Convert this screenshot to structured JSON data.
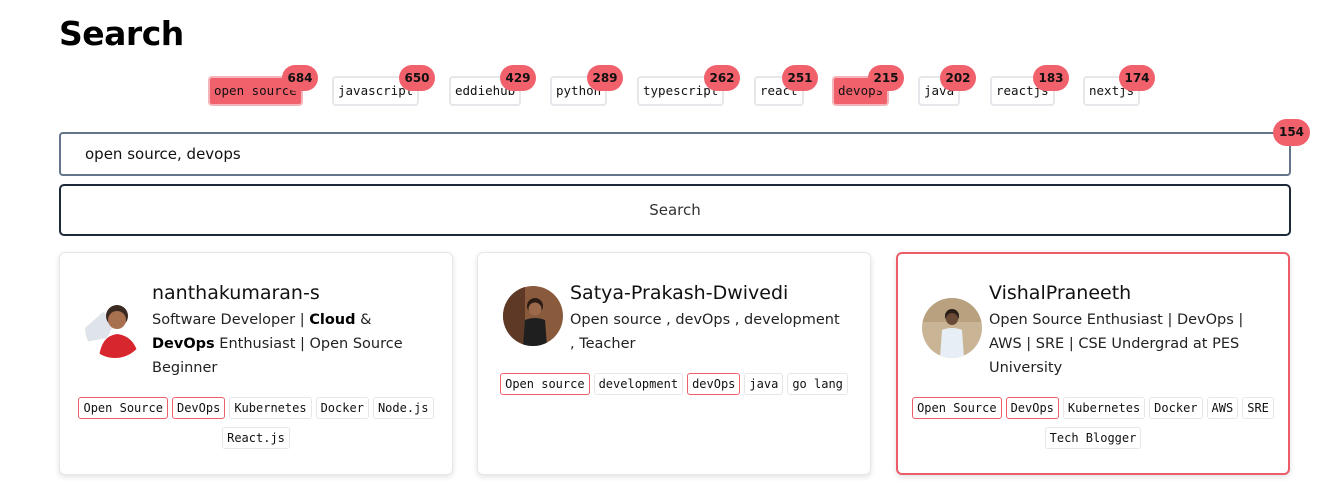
{
  "page": {
    "title": "Search"
  },
  "popular_tags": [
    {
      "label": "open source",
      "count": "684",
      "selected": true
    },
    {
      "label": "javascript",
      "count": "650",
      "selected": false
    },
    {
      "label": "eddiehub",
      "count": "429",
      "selected": false
    },
    {
      "label": "python",
      "count": "289",
      "selected": false
    },
    {
      "label": "typescript",
      "count": "262",
      "selected": false
    },
    {
      "label": "react",
      "count": "251",
      "selected": false
    },
    {
      "label": "devops",
      "count": "215",
      "selected": true
    },
    {
      "label": "java",
      "count": "202",
      "selected": false
    },
    {
      "label": "reactjs",
      "count": "183",
      "selected": false
    },
    {
      "label": "nextjs",
      "count": "174",
      "selected": false
    }
  ],
  "search": {
    "value": "open source, devops",
    "result_count": "154",
    "button_label": "Search"
  },
  "results": [
    {
      "username": "nanthakumaran-s",
      "bio_parts": [
        {
          "text": "Software Developer | ",
          "bold": false
        },
        {
          "text": "Cloud",
          "bold": true
        },
        {
          "text": " & ",
          "bold": false
        },
        {
          "text": "DevOps",
          "bold": true
        },
        {
          "text": " Enthusiast | Open Source Beginner",
          "bold": false
        }
      ],
      "tags": [
        {
          "label": "Open Source",
          "match": true
        },
        {
          "label": "DevOps",
          "match": true
        },
        {
          "label": "Kubernetes",
          "match": false
        },
        {
          "label": "Docker",
          "match": false
        },
        {
          "label": "Node.js",
          "match": false
        },
        {
          "label": "React.js",
          "match": false
        }
      ],
      "highlighted": false
    },
    {
      "username": "Satya-Prakash-Dwivedi",
      "bio_parts": [
        {
          "text": "Open source , devOps , development , Teacher",
          "bold": false
        }
      ],
      "tags": [
        {
          "label": "Open source",
          "match": true
        },
        {
          "label": "development",
          "match": false
        },
        {
          "label": "devOps",
          "match": true
        },
        {
          "label": "java",
          "match": false
        },
        {
          "label": "go lang",
          "match": false
        }
      ],
      "highlighted": false
    },
    {
      "username": "VishalPraneeth",
      "bio_parts": [
        {
          "text": "Open Source Enthusiast | DevOps | AWS | SRE | CSE Undergrad at PES University",
          "bold": false
        }
      ],
      "tags": [
        {
          "label": "Open Source",
          "match": true
        },
        {
          "label": "DevOps",
          "match": true
        },
        {
          "label": "Kubernetes",
          "match": false
        },
        {
          "label": "Docker",
          "match": false
        },
        {
          "label": "AWS",
          "match": false
        },
        {
          "label": "SRE",
          "match": false
        },
        {
          "label": "Tech Blogger",
          "match": false
        }
      ],
      "highlighted": true
    }
  ],
  "colors": {
    "accent": "#f0616c",
    "highlight_border": "#ec5d69",
    "input_border": "#64748b",
    "button_border": "#1e293b"
  }
}
